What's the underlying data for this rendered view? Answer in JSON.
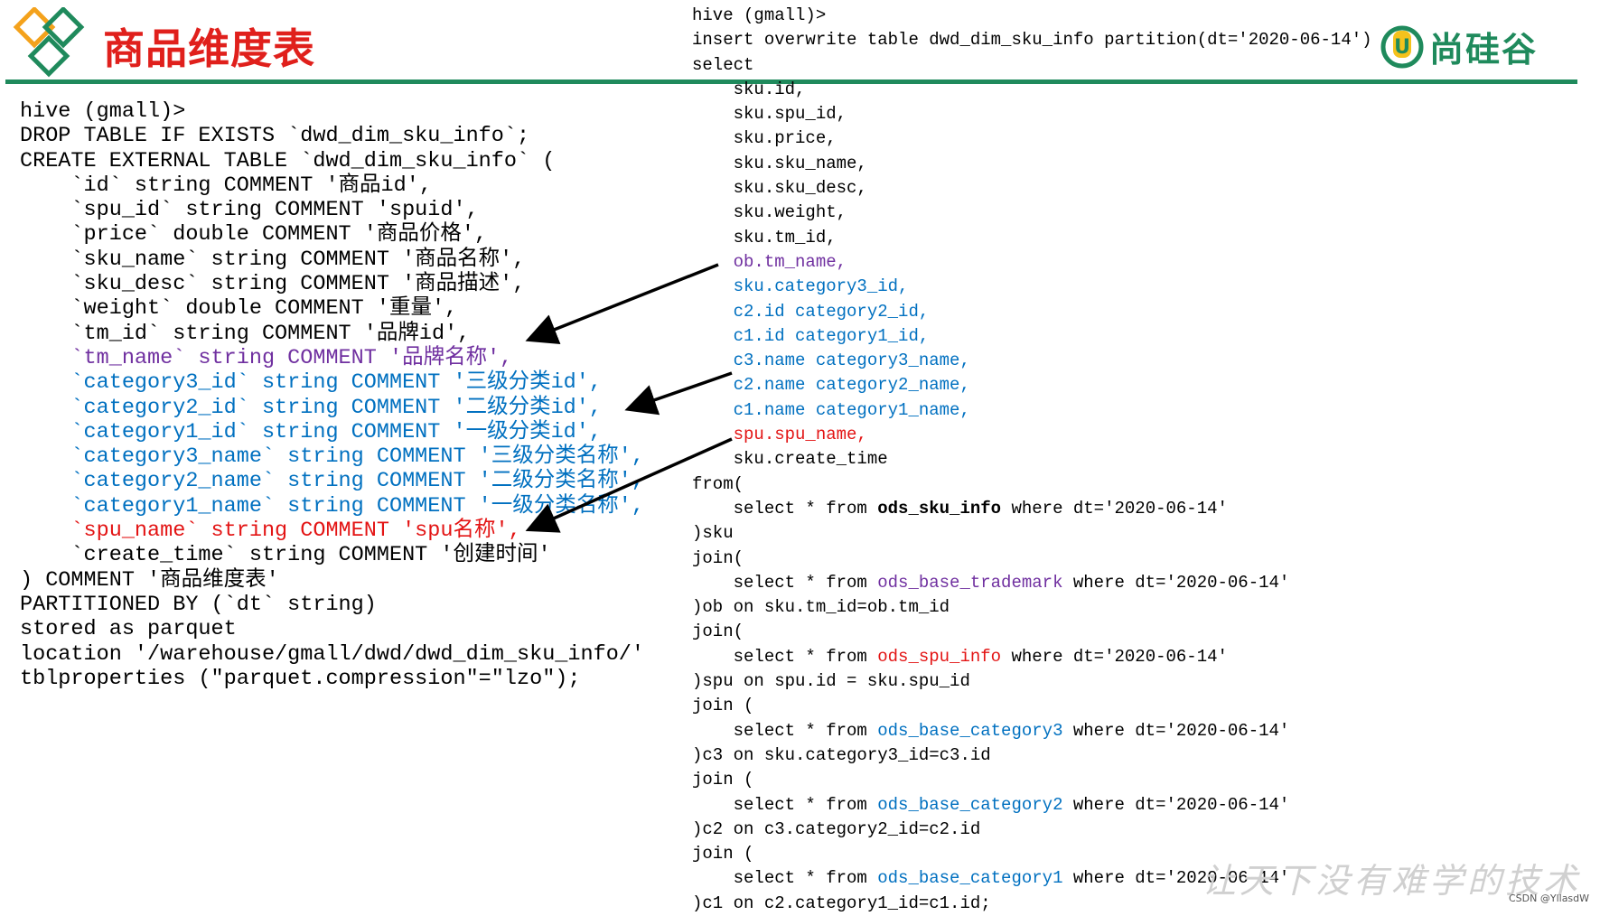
{
  "header": {
    "title": "商品维度表",
    "brand_name": "尚硅谷",
    "brand_mark_letter": "U"
  },
  "ddl": {
    "lines": [
      {
        "text": "hive (gmall)>",
        "style": ""
      },
      {
        "text": "DROP TABLE IF EXISTS `dwd_dim_sku_info`;",
        "style": ""
      },
      {
        "text": "CREATE EXTERNAL TABLE `dwd_dim_sku_info` (",
        "style": ""
      },
      {
        "text": "    `id` string COMMENT '商品id',",
        "style": ""
      },
      {
        "text": "    `spu_id` string COMMENT 'spuid',",
        "style": ""
      },
      {
        "text": "    `price` double COMMENT '商品价格',",
        "style": ""
      },
      {
        "text": "    `sku_name` string COMMENT '商品名称',",
        "style": ""
      },
      {
        "text": "    `sku_desc` string COMMENT '商品描述',",
        "style": ""
      },
      {
        "text": "    `weight` double COMMENT '重量',",
        "style": ""
      },
      {
        "text": "    `tm_id` string COMMENT '品牌id',",
        "style": ""
      },
      {
        "text": "    `tm_name` string COMMENT '品牌名称',",
        "style": "purple"
      },
      {
        "text": "    `category3_id` string COMMENT '三级分类id',",
        "style": "blue"
      },
      {
        "text": "    `category2_id` string COMMENT '二级分类id',",
        "style": "blue"
      },
      {
        "text": "    `category1_id` string COMMENT '一级分类id',",
        "style": "blue"
      },
      {
        "text": "    `category3_name` string COMMENT '三级分类名称',",
        "style": "blue"
      },
      {
        "text": "    `category2_name` string COMMENT '二级分类名称',",
        "style": "blue"
      },
      {
        "text": "    `category1_name` string COMMENT '一级分类名称',",
        "style": "blue"
      },
      {
        "text": "    `spu_name` string COMMENT 'spu名称',",
        "style": "red"
      },
      {
        "text": "    `create_time` string COMMENT '创建时间'",
        "style": ""
      },
      {
        "text": ") COMMENT '商品维度表'",
        "style": ""
      },
      {
        "text": "PARTITIONED BY (`dt` string)",
        "style": ""
      },
      {
        "text": "stored as parquet",
        "style": ""
      },
      {
        "text": "location '/warehouse/gmall/dwd/dwd_dim_sku_info/'",
        "style": ""
      },
      {
        "text": "tblproperties (\"parquet.compression\"=\"lzo\");",
        "style": ""
      }
    ]
  },
  "dml": {
    "lines": [
      {
        "segments": [
          {
            "text": "hive (gmall)>",
            "style": ""
          }
        ]
      },
      {
        "segments": [
          {
            "text": "insert overwrite table dwd_dim_sku_info partition(dt='2020-06-14')",
            "style": ""
          }
        ]
      },
      {
        "segments": [
          {
            "text": "select",
            "style": ""
          }
        ]
      },
      {
        "segments": [
          {
            "text": "    sku.id,",
            "style": ""
          }
        ]
      },
      {
        "segments": [
          {
            "text": "    sku.spu_id,",
            "style": ""
          }
        ]
      },
      {
        "segments": [
          {
            "text": "    sku.price,",
            "style": ""
          }
        ]
      },
      {
        "segments": [
          {
            "text": "    sku.sku_name,",
            "style": ""
          }
        ]
      },
      {
        "segments": [
          {
            "text": "    sku.sku_desc,",
            "style": ""
          }
        ]
      },
      {
        "segments": [
          {
            "text": "    sku.weight,",
            "style": ""
          }
        ]
      },
      {
        "segments": [
          {
            "text": "    sku.tm_id,",
            "style": ""
          }
        ]
      },
      {
        "segments": [
          {
            "text": "    ob.tm_name,",
            "style": "purple"
          }
        ]
      },
      {
        "segments": [
          {
            "text": "    sku.category3_id,",
            "style": "blue"
          }
        ]
      },
      {
        "segments": [
          {
            "text": "    c2.id category2_id,",
            "style": "blue"
          }
        ]
      },
      {
        "segments": [
          {
            "text": "    c1.id category1_id,",
            "style": "blue"
          }
        ]
      },
      {
        "segments": [
          {
            "text": "    c3.name category3_name,",
            "style": "blue"
          }
        ]
      },
      {
        "segments": [
          {
            "text": "    c2.name category2_name,",
            "style": "blue"
          }
        ]
      },
      {
        "segments": [
          {
            "text": "    c1.name category1_name,",
            "style": "blue"
          }
        ]
      },
      {
        "segments": [
          {
            "text": "    spu.spu_name,",
            "style": "red"
          }
        ]
      },
      {
        "segments": [
          {
            "text": "    sku.create_time",
            "style": ""
          }
        ]
      },
      {
        "segments": [
          {
            "text": "from(",
            "style": ""
          }
        ]
      },
      {
        "segments": [
          {
            "text": "    select * from ",
            "style": ""
          },
          {
            "text": "ods_sku_info",
            "style": "bold"
          },
          {
            "text": " where dt='2020-06-14'",
            "style": ""
          }
        ]
      },
      {
        "segments": [
          {
            "text": ")sku",
            "style": ""
          }
        ]
      },
      {
        "segments": [
          {
            "text": "join(",
            "style": ""
          }
        ]
      },
      {
        "segments": [
          {
            "text": "    select * from ",
            "style": ""
          },
          {
            "text": "ods_base_trademark",
            "style": "purple"
          },
          {
            "text": " where dt='2020-06-14'",
            "style": ""
          }
        ]
      },
      {
        "segments": [
          {
            "text": ")ob on sku.tm_id=ob.tm_id",
            "style": ""
          }
        ]
      },
      {
        "segments": [
          {
            "text": "join(",
            "style": ""
          }
        ]
      },
      {
        "segments": [
          {
            "text": "    select * from ",
            "style": ""
          },
          {
            "text": "ods_spu_info",
            "style": "red"
          },
          {
            "text": " where dt='2020-06-14'",
            "style": ""
          }
        ]
      },
      {
        "segments": [
          {
            "text": ")spu on spu.id = sku.spu_id",
            "style": ""
          }
        ]
      },
      {
        "segments": [
          {
            "text": "join (",
            "style": ""
          }
        ]
      },
      {
        "segments": [
          {
            "text": "    select * from ",
            "style": ""
          },
          {
            "text": "ods_base_category3",
            "style": "blue"
          },
          {
            "text": " where dt='2020-06-14'",
            "style": ""
          }
        ]
      },
      {
        "segments": [
          {
            "text": ")c3 on sku.category3_id=c3.id",
            "style": ""
          }
        ]
      },
      {
        "segments": [
          {
            "text": "join (",
            "style": ""
          }
        ]
      },
      {
        "segments": [
          {
            "text": "    select * from ",
            "style": ""
          },
          {
            "text": "ods_base_category2",
            "style": "blue"
          },
          {
            "text": " where dt='2020-06-14'",
            "style": ""
          }
        ]
      },
      {
        "segments": [
          {
            "text": ")c2 on c3.category2_id=c2.id",
            "style": ""
          }
        ]
      },
      {
        "segments": [
          {
            "text": "join (",
            "style": ""
          }
        ]
      },
      {
        "segments": [
          {
            "text": "    select * from ",
            "style": ""
          },
          {
            "text": "ods_base_category1",
            "style": "blue"
          },
          {
            "text": " where dt='2020-06-14'",
            "style": ""
          }
        ]
      },
      {
        "segments": [
          {
            "text": ")c1 on c2.category1_id=c1.id;",
            "style": ""
          }
        ]
      }
    ]
  },
  "footer": {
    "watermark": "让天下没有难学的技术",
    "credit": "CSDN @YllasdW"
  },
  "colors": {
    "title_red": "#e0201c",
    "brand_green": "#1f8a5c",
    "logo_orange": "#f4a21c",
    "highlight_purple": "#7030a0",
    "highlight_blue": "#0070c0",
    "highlight_red": "#e31414"
  },
  "icons": [
    "diamond-logo-icon",
    "brand-u-icon",
    "arrow-icon"
  ]
}
